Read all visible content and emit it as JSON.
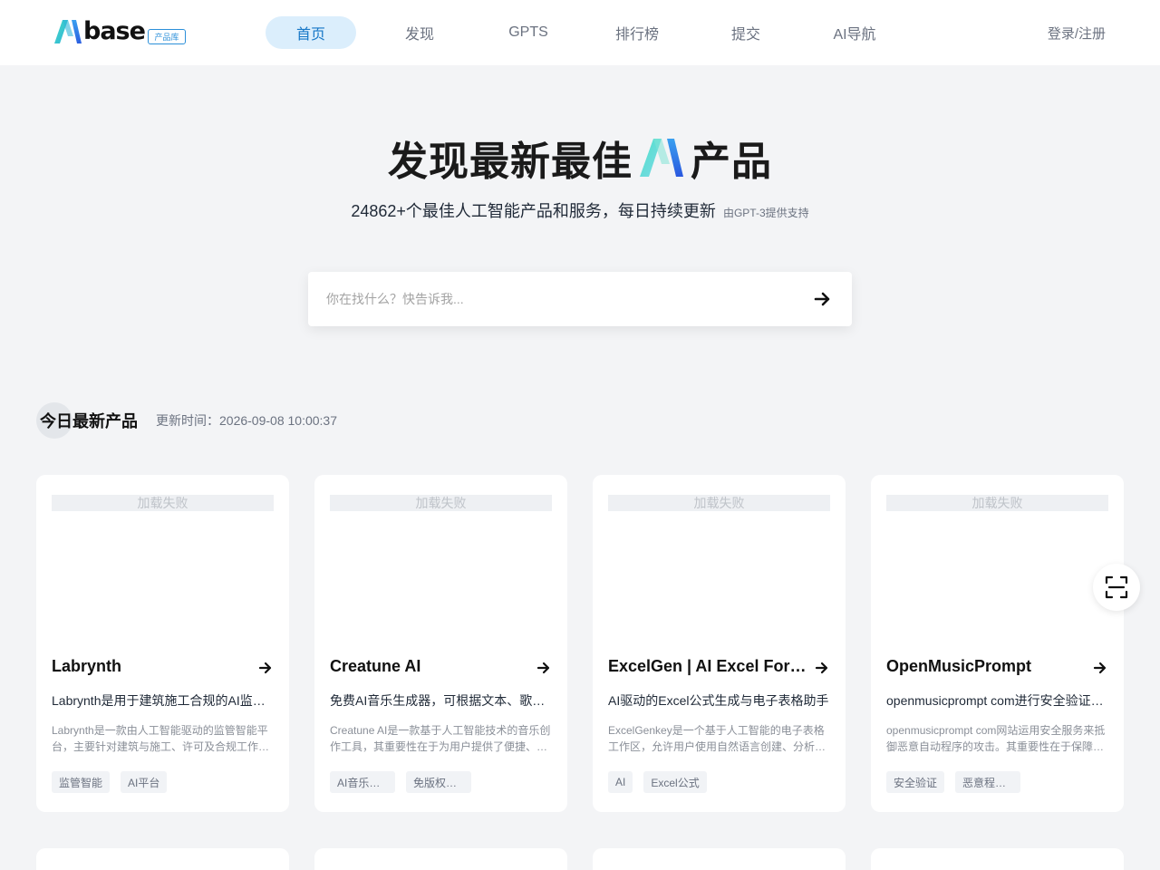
{
  "header": {
    "logo_text": "base",
    "logo_tag": "产品库",
    "nav": [
      {
        "label": "首页",
        "active": true
      },
      {
        "label": "发现"
      },
      {
        "label": "GPTS"
      },
      {
        "label": "排行榜"
      },
      {
        "label": "提交"
      },
      {
        "label": "AI导航"
      }
    ],
    "login": "登录/注册"
  },
  "hero": {
    "title_left": "发现最新最佳",
    "title_right": "产品",
    "subtitle": "24862+个最佳人工智能产品和服务，每日持续更新",
    "powered_by": "由GPT-3提供支持"
  },
  "search": {
    "placeholder": "你在找什么？快告诉我...",
    "button_icon": "arrow-right-icon"
  },
  "section": {
    "title": "今日最新产品",
    "update_time": "更新时间：2026-09-08 10:00:37"
  },
  "cards": [
    {
      "image_text": "加载失败",
      "name": "Labrynth",
      "tagline": "Labrynth是用于建筑施工合规的AI监管智能平台",
      "desc": "Labrynth是一款由人工智能驱动的监管智能平台，主要针对建筑与施工、许可及合规工作流程。",
      "tags": [
        "监管智能",
        "AI平台"
      ]
    },
    {
      "image_text": "加载失败",
      "name": "Creatune AI",
      "tagline": "免费AI音乐生成器，可根据文本、歌词生成音乐",
      "desc": "Creatune AI是一款基于人工智能技术的音乐创作工具，其重要性在于为用户提供了便捷、高效的音乐创作方式。",
      "tags": [
        "AI音乐生成",
        "免版权音乐"
      ]
    },
    {
      "image_text": "加载失败",
      "name": "ExcelGen | AI Excel Formula Generator",
      "tagline": "AI驱动的Excel公式生成与电子表格助手",
      "desc": "ExcelGenkey是一个基于人工智能的电子表格工作区，允许用户使用自然语言创建、分析和处理数据。",
      "tags": [
        "AI",
        "Excel公式"
      ]
    },
    {
      "image_text": "加载失败",
      "name": "OpenMusicPrompt",
      "tagline": "openmusicprompt com进行安全验证以抵御攻击",
      "desc": "openmusicprompt com网站运用安全服务来抵御恶意自动程序的攻击。其重要性在于保障网站的安全稳定运行。",
      "tags": [
        "安全验证",
        "恶意程序防护"
      ]
    }
  ],
  "colors": {
    "accent": "#1677c7",
    "nav_active_bg": "#dbeefc",
    "logo_cyan": "#3fd0c9",
    "logo_blue": "#2b6fe0"
  }
}
